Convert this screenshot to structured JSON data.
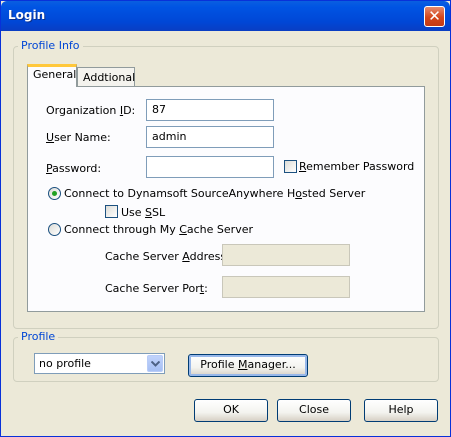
{
  "window": {
    "title": "Login",
    "close_glyph": "✕"
  },
  "profile_info": {
    "legend": "Profile Info",
    "tabs": [
      {
        "label": "General",
        "active": true
      },
      {
        "label": "Addtional",
        "active": false
      }
    ],
    "general": {
      "org_id_label_pre": "Organization ",
      "org_id_label_ul": "I",
      "org_id_label_post": "D:",
      "org_id_value": "87",
      "username_label_ul": "U",
      "username_label_post": "ser Name:",
      "username_value": "admin",
      "password_label_ul": "P",
      "password_label_post": "assword:",
      "password_value": "",
      "remember_label_ul": "R",
      "remember_label_post": "emember Password",
      "remember_checked": false,
      "radio_hosted_pre": "Connect to Dynamsoft SourceAnywhere H",
      "radio_hosted_ul": "o",
      "radio_hosted_post": "sted Server",
      "radio_hosted_selected": true,
      "use_ssl_pre": "Use ",
      "use_ssl_ul": "S",
      "use_ssl_post": "SL",
      "use_ssl_checked": false,
      "radio_cache_pre": "Connect through My ",
      "radio_cache_ul": "C",
      "radio_cache_post": "ache Server",
      "radio_cache_selected": false,
      "cache_address_pre": "Cache Server ",
      "cache_address_ul": "A",
      "cache_address_post": "ddress:",
      "cache_address_value": "",
      "cache_port_pre": "Cache Server Por",
      "cache_port_ul": "t",
      "cache_port_post": ":",
      "cache_port_value": ""
    }
  },
  "profile": {
    "legend": "Profile",
    "selected": "no profile",
    "manager_pre": "Profile ",
    "manager_ul": "M",
    "manager_post": "anager..."
  },
  "buttons": {
    "ok": "OK",
    "close": "Close",
    "help": "Help"
  },
  "colors": {
    "title_bar": "#0054e3",
    "dialog_bg": "#ece9d8",
    "radio_dot": "#21a121",
    "legend_text": "#0046d5",
    "active_tab_accent": "#ffc83c"
  }
}
